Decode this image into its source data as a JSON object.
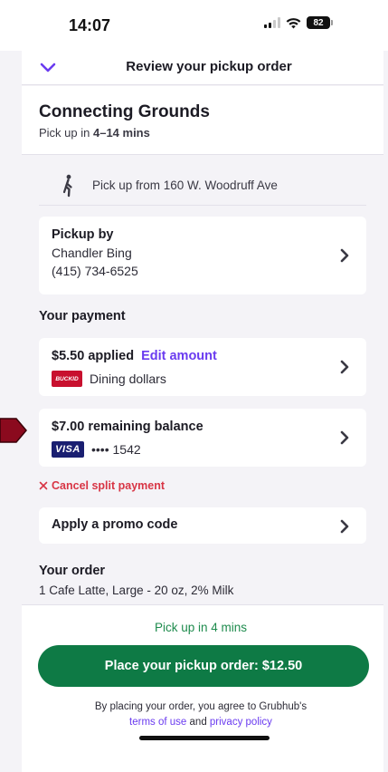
{
  "status_bar": {
    "time": "14:07",
    "battery": "82"
  },
  "header": {
    "title": "Review your pickup order"
  },
  "store": {
    "name": "Connecting Grounds",
    "eta_prefix": "Pick up in ",
    "eta_value": "4–14 mins"
  },
  "pickup_location": {
    "text": "Pick up from 160 W. Woodruff Ave"
  },
  "pickup_by": {
    "title": "Pickup by",
    "name": "Chandler Bing",
    "phone": "(415) 734-6525"
  },
  "payment": {
    "section_label": "Your payment",
    "applied": {
      "amount": "$5.50 applied",
      "edit_label": "Edit amount",
      "method_logo": "BUCKID",
      "method_name": "Dining dollars"
    },
    "remaining": {
      "amount": "$7.00 remaining balance",
      "card_logo": "VISA",
      "card_masked": "•••• 1542"
    },
    "cancel_split": "Cancel split payment"
  },
  "promo": {
    "label": "Apply a promo code"
  },
  "order": {
    "section_label": "Your order",
    "first_line": "1 Cafe Latte, Large - 20 oz, 2% Milk"
  },
  "footer": {
    "eta": "Pick up in 4 mins",
    "place_order_label": "Place your pickup order: $12.50",
    "legal_prefix": "By placing your order, you agree to Grubhub's",
    "terms_label": "terms of use",
    "legal_and": " and ",
    "privacy_label": "privacy policy"
  },
  "colors": {
    "accent_purple": "#6a3bf0",
    "primary_green": "#0e7a45",
    "eta_green": "#1e8b4d",
    "error_red": "#d83545",
    "marker_red": "#8b0a1e"
  },
  "icons": [
    "chevron-down-icon",
    "walking-person-icon",
    "chevron-right-icon",
    "close-x-icon",
    "signal-icon",
    "wifi-icon",
    "battery-icon"
  ]
}
